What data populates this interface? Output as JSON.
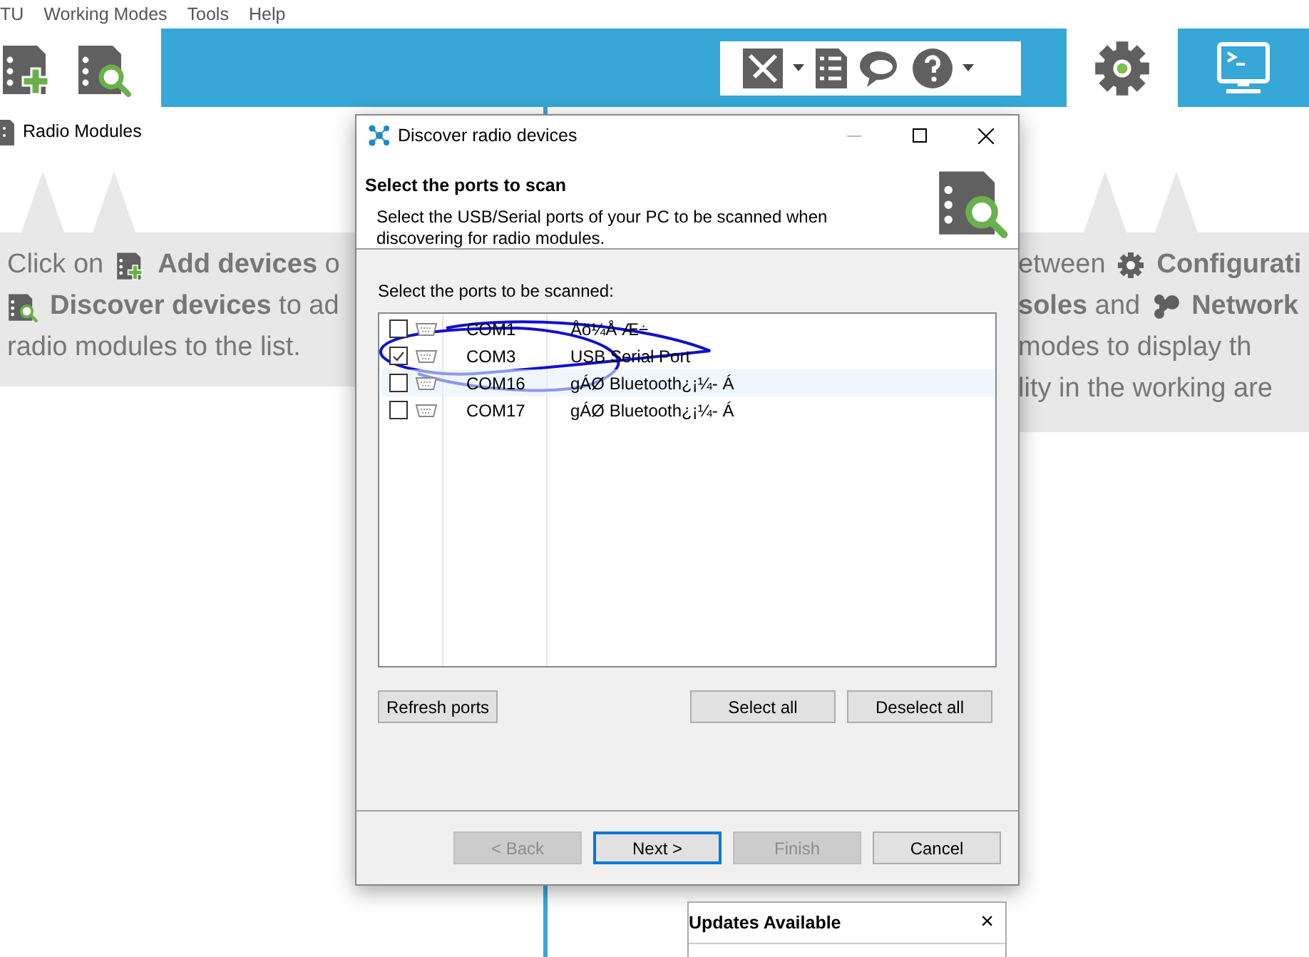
{
  "menu": [
    {
      "label": "TU"
    },
    {
      "label": "Working Modes"
    },
    {
      "label": "Tools"
    },
    {
      "label": "Help"
    }
  ],
  "mode_tabs": [
    {
      "selected": true
    },
    {
      "selected": false
    }
  ],
  "left_panel": {
    "title": "Radio Modules"
  },
  "left_hint": [
    {
      "before": "Click on",
      "after": "**Add devices** o"
    },
    {
      "after": "**Discover devices** to ad"
    },
    {
      "before": "radio modules to the list."
    }
  ],
  "right_hint": [
    {
      "before": "etween",
      "after": "**Configurati**"
    },
    {
      "before": "**soles** and",
      "after": "**Network**"
    },
    {
      "before": "modes  to  display  th"
    },
    {
      "before": "lity in  the working are"
    }
  ],
  "dialog": {
    "title": "Discover radio devices",
    "heading": "Select the ports to scan",
    "description": "Select the USB/Serial ports of your PC to be scanned when discovering for radio modules.",
    "list_label": "Select the ports to be scanned:",
    "ports": [
      {
        "name": "COM1",
        "description": "Åö¼Å Æ÷",
        "checked": false,
        "selected": false
      },
      {
        "name": "COM3",
        "description": "USB Serial Port",
        "checked": true,
        "selected": false
      },
      {
        "name": "COM16",
        "description": "gÁØ Bluetooth¿¡¼- Á",
        "checked": false,
        "selected": true
      },
      {
        "name": "COM17",
        "description": "gÁØ Bluetooth¿¡¼- Á",
        "checked": false,
        "selected": false
      }
    ],
    "list_buttons": [
      {
        "label": "Refresh ports"
      },
      {
        "label": "Select all"
      },
      {
        "label": "Deselect all"
      }
    ],
    "footer_buttons": [
      {
        "label": "< Back",
        "disabled": true,
        "default": false
      },
      {
        "label": "Next >",
        "disabled": false,
        "default": true
      },
      {
        "label": "Finish",
        "disabled": true,
        "default": false
      },
      {
        "label": "Cancel",
        "disabled": false,
        "default": false
      }
    ]
  },
  "updates_popup": {
    "title": "Updates Available",
    "close": "×"
  }
}
